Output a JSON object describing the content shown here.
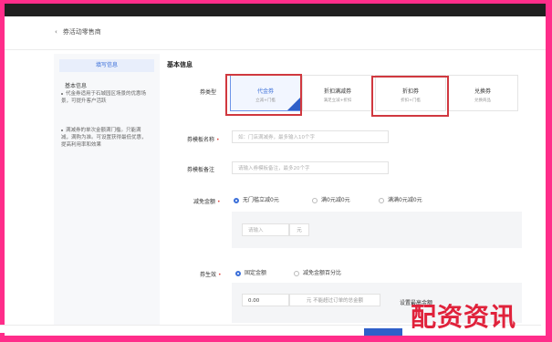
{
  "breadcrumb": {
    "back_icon": "‹",
    "text": "券活动零售商"
  },
  "sidebar": {
    "title": "填写信息",
    "heading": "基本信息",
    "items": [
      "代金券适用于石城园区场景的优惠场景，可提升客户活跃",
      "满减券的单次金额满门槛。只能满减，满购为准。可设置获得最低优惠，提高利用率和效果"
    ]
  },
  "form": {
    "section_title": "基本信息",
    "type_label": "券类型",
    "cards": [
      {
        "title": "代金券",
        "sub": "立减+门槛"
      },
      {
        "title": "折扣满减券",
        "sub": "满足立减+折扣"
      },
      {
        "title": "折扣券",
        "sub": "折扣+门槛"
      },
      {
        "title": "兑换券",
        "sub": "兑换商品"
      }
    ],
    "name_label": "券模板名称",
    "name_placeholder": "如：门店满减券，最多输入10个字",
    "note_label": "券模板备注",
    "note_placeholder": "请输入券模板备注，最多20个字",
    "threshold_label": "减免金额",
    "threshold_options": [
      "无门槛立减0元",
      "满0元减0元",
      "满满0元减0元"
    ],
    "amount_placeholder": "请输入",
    "amount_unit": "元",
    "condition_label": "券生效",
    "condition_options": [
      "固定金额",
      "减免金额百分比"
    ],
    "condition_value": "0.00",
    "condition_hint": "元 不能超过订单的总金额",
    "condition_extra": "设置最高金额"
  },
  "watermark": "配资资讯"
}
